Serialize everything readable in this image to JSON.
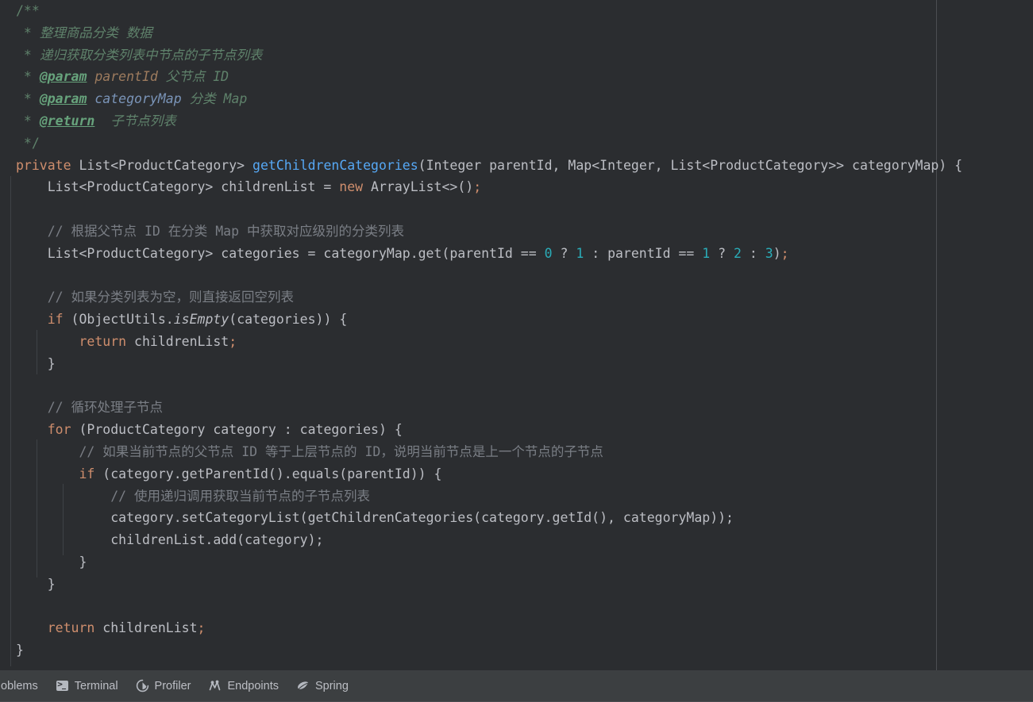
{
  "editor": {
    "language": "Java",
    "right_margin_column_guide": true,
    "colors": {
      "background": "#2B2D30",
      "default_text": "#BCBEC4",
      "keyword": "#CF8E6D",
      "method": "#56A8F5",
      "number": "#2AACB8",
      "line_comment": "#7A7E85",
      "javadoc": "#5F826B",
      "javadoc_tag": "#67A37C",
      "guide_line": "#3F4246"
    },
    "code_lines": [
      "/**",
      " * 整理商品分类 数据",
      " * 递归获取分类列表中节点的子节点列表",
      " * @param parentId 父节点 ID",
      " * @param categoryMap 分类 Map",
      " * @return 子节点列表",
      " */",
      "private List<ProductCategory> getChildrenCategories(Integer parentId, Map<Integer, List<ProductCategory>> categoryMap) {",
      "    List<ProductCategory> childrenList = new ArrayList<>();",
      "",
      "    // 根据父节点 ID 在分类 Map 中获取对应级别的分类列表",
      "    List<ProductCategory> categories = categoryMap.get(parentId == 0 ? 1 : parentId == 1 ? 2 : 3);",
      "",
      "    // 如果分类列表为空，则直接返回空列表",
      "    if (ObjectUtils.isEmpty(categories)) {",
      "        return childrenList;",
      "    }",
      "",
      "    // 循环处理子节点",
      "    for (ProductCategory category : categories) {",
      "        // 如果当前节点的父节点 ID 等于上层节点的 ID，说明当前节点是上一个节点的子节点",
      "        if (category.getParentId().equals(parentId)) {",
      "            // 使用递归调用获取当前节点的子节点列表",
      "            category.setCategoryList(getChildrenCategories(category.getId(), categoryMap));",
      "            childrenList.add(category);",
      "        }",
      "    }",
      "",
      "    return childrenList;",
      "}"
    ],
    "tokens": {
      "javadoc_open": "/**",
      "javadoc_close": " */",
      "doc_star": " * ",
      "doc_line1": "整理商品分类 数据",
      "doc_line2": "递归获取分类列表中节点的子节点列表",
      "tag_param": "@param",
      "param1_name": "parentId",
      "param1_desc": "父节点 ID",
      "param2_name": "categoryMap",
      "param2_desc": "分类 Map",
      "tag_return": "@return",
      "return_desc": "子节点列表",
      "kw_private": "private",
      "kw_new": "new",
      "kw_if": "if",
      "kw_for": "for",
      "kw_return": "return",
      "type_list": "List<ProductCategory>",
      "method_name": "getChildrenCategories",
      "sig_params": "(Integer parentId, Map<Integer, List<ProductCategory>> categoryMap) {",
      "decl_children": "    List<ProductCategory> childrenList = ",
      "arraylist": "ArrayList<>()",
      "comment1": "// 根据父节点 ID 在分类 Map 中获取对应级别的分类列表",
      "decl_categories": "    List<ProductCategory> categories = categoryMap.get(parentId ",
      "eq": "==",
      "num0": "0",
      "num1": "1",
      "num2": "2",
      "num3": "3",
      "comment2": "// 如果分类列表为空，则直接返回空列表",
      "objectutils": "ObjectUtils",
      "isempty": "isEmpty",
      "categories_arg": "(categories)) {",
      "childrenlist": "childrenList",
      "brace_close": "}",
      "comment3": "// 循环处理子节点",
      "for_header": "(ProductCategory category : categories) {",
      "comment4": "// 如果当前节点的父节点 ID 等于上层节点的 ID，说明当前节点是上一个节点的子节点",
      "if_equals": "(category.getParentId().equals(parentId)) {",
      "comment5": "// 使用递归调用获取当前节点的子节点列表",
      "set_category_list": "category.setCategoryList(getChildrenCategories(category.getId(), categoryMap));",
      "add_category": "childrenList.add(category);"
    }
  },
  "toolbar": {
    "items": [
      {
        "id": "problems",
        "label": "oblems",
        "icon": "warning-icon"
      },
      {
        "id": "terminal",
        "label": "Terminal",
        "icon": "terminal-icon"
      },
      {
        "id": "profiler",
        "label": "Profiler",
        "icon": "profiler-icon"
      },
      {
        "id": "endpoints",
        "label": "Endpoints",
        "icon": "endpoints-icon"
      },
      {
        "id": "spring",
        "label": "Spring",
        "icon": "spring-leaf-icon"
      }
    ]
  }
}
